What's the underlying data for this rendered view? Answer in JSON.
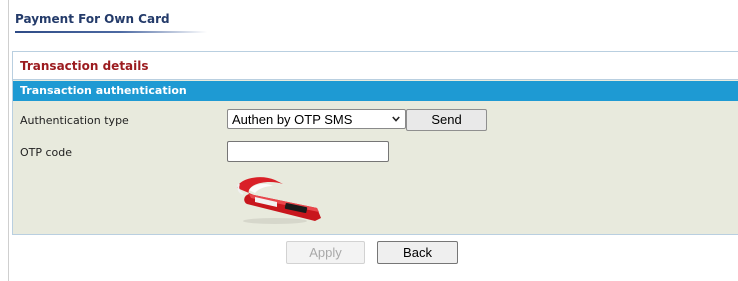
{
  "page": {
    "title": "Payment For Own Card"
  },
  "panel": {
    "title": "Transaction details",
    "section": {
      "title": "Transaction authentication",
      "auth_type_label": "Authentication type",
      "auth_type_selected": "Authen by OTP SMS",
      "send_label": "Send",
      "otp_label": "OTP code",
      "otp_value": ""
    }
  },
  "actions": {
    "apply_label": "Apply",
    "back_label": "Back"
  },
  "colors": {
    "title_text": "#243b6a",
    "panel_title_text": "#9b1b1f",
    "section_bar": "#1e9ad3",
    "panel_background": "#e8eadd"
  },
  "icons": {
    "token": "otp-token-icon",
    "dropdown": "chevron-down-icon"
  }
}
